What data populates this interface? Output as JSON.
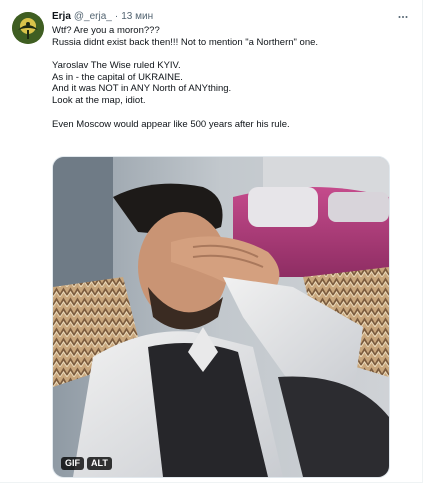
{
  "tweet": {
    "author_name": "Erja",
    "author_handle": "@_erja_",
    "separator": "·",
    "time": "13 мин",
    "lines": [
      "Wtf? Are you a moron???",
      "Russia didnt exist back then!!! Not to mention \"a Northern\" one.",
      "",
      "Yaroslav The Wise ruled KYIV.",
      "As in - the capital of UKRAINE.",
      "And it was NOT in ANY North of ANYthing.",
      "Look at the map, idiot.",
      "",
      "Even Moscow would appear like 500 years after his rule."
    ]
  },
  "media": {
    "badges": [
      "GIF",
      "ALT"
    ]
  },
  "icons": {
    "more": "more-horizontal-icon",
    "avatar": "avatar-emblem"
  },
  "colors": {
    "text": "#0f1419",
    "secondary": "#536471",
    "border": "#eff3f4"
  }
}
